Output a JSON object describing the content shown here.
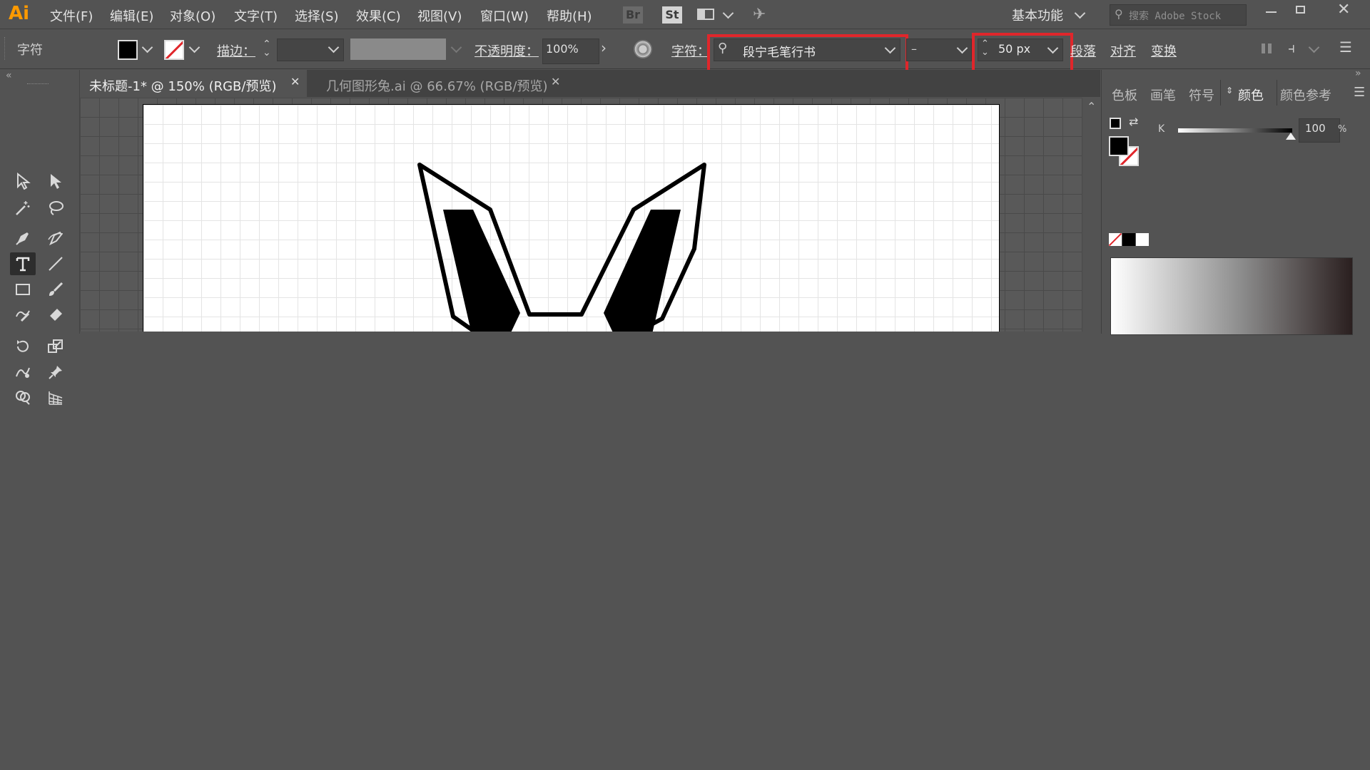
{
  "app": {
    "logo": "Ai"
  },
  "menu": {
    "items": [
      "文件(F)",
      "编辑(E)",
      "对象(O)",
      "文字(T)",
      "选择(S)",
      "效果(C)",
      "视图(V)",
      "窗口(W)",
      "帮助(H)"
    ],
    "bridge": "Br",
    "stock": "St",
    "workspace": "基本功能",
    "search_placeholder": "搜索 Adobe Stock"
  },
  "control_bar": {
    "panel_label": "字符",
    "stroke_label": "描边：",
    "opacity_label": "不透明度：",
    "opacity_value": "100%",
    "char_label": "字符：",
    "font_family": "段宁毛笔行书",
    "font_style": "–",
    "font_size": "50 px",
    "paragraph": "段落",
    "align": "对齐",
    "transform": "变换"
  },
  "tabs": [
    {
      "label": "未标题-1* @ 150% (RGB/预览)",
      "active": true
    },
    {
      "label": "几何图形兔.ai @ 66.67% (RGB/预览)",
      "active": false
    }
  ],
  "color_panel": {
    "tabs": [
      "色板",
      "画笔",
      "符号",
      "颜色",
      "颜色参考"
    ],
    "active_tab": "颜色",
    "channel": "K",
    "value": "100",
    "unit": "%"
  },
  "colors": {
    "highlight": "#e0262b",
    "fill": "#000000",
    "ui_bg": "#535353"
  },
  "tools": [
    "selection-icon",
    "direct-selection-icon",
    "magic-wand-icon",
    "lasso-icon",
    "pen-icon",
    "curvature-icon",
    "type-icon",
    "line-icon",
    "rectangle-icon",
    "paintbrush-icon",
    "shaper-icon",
    "eraser-icon",
    "rotate-icon",
    "scale-icon",
    "warp-icon",
    "pin-icon",
    "shape-builder-icon",
    "perspective-grid-icon"
  ]
}
